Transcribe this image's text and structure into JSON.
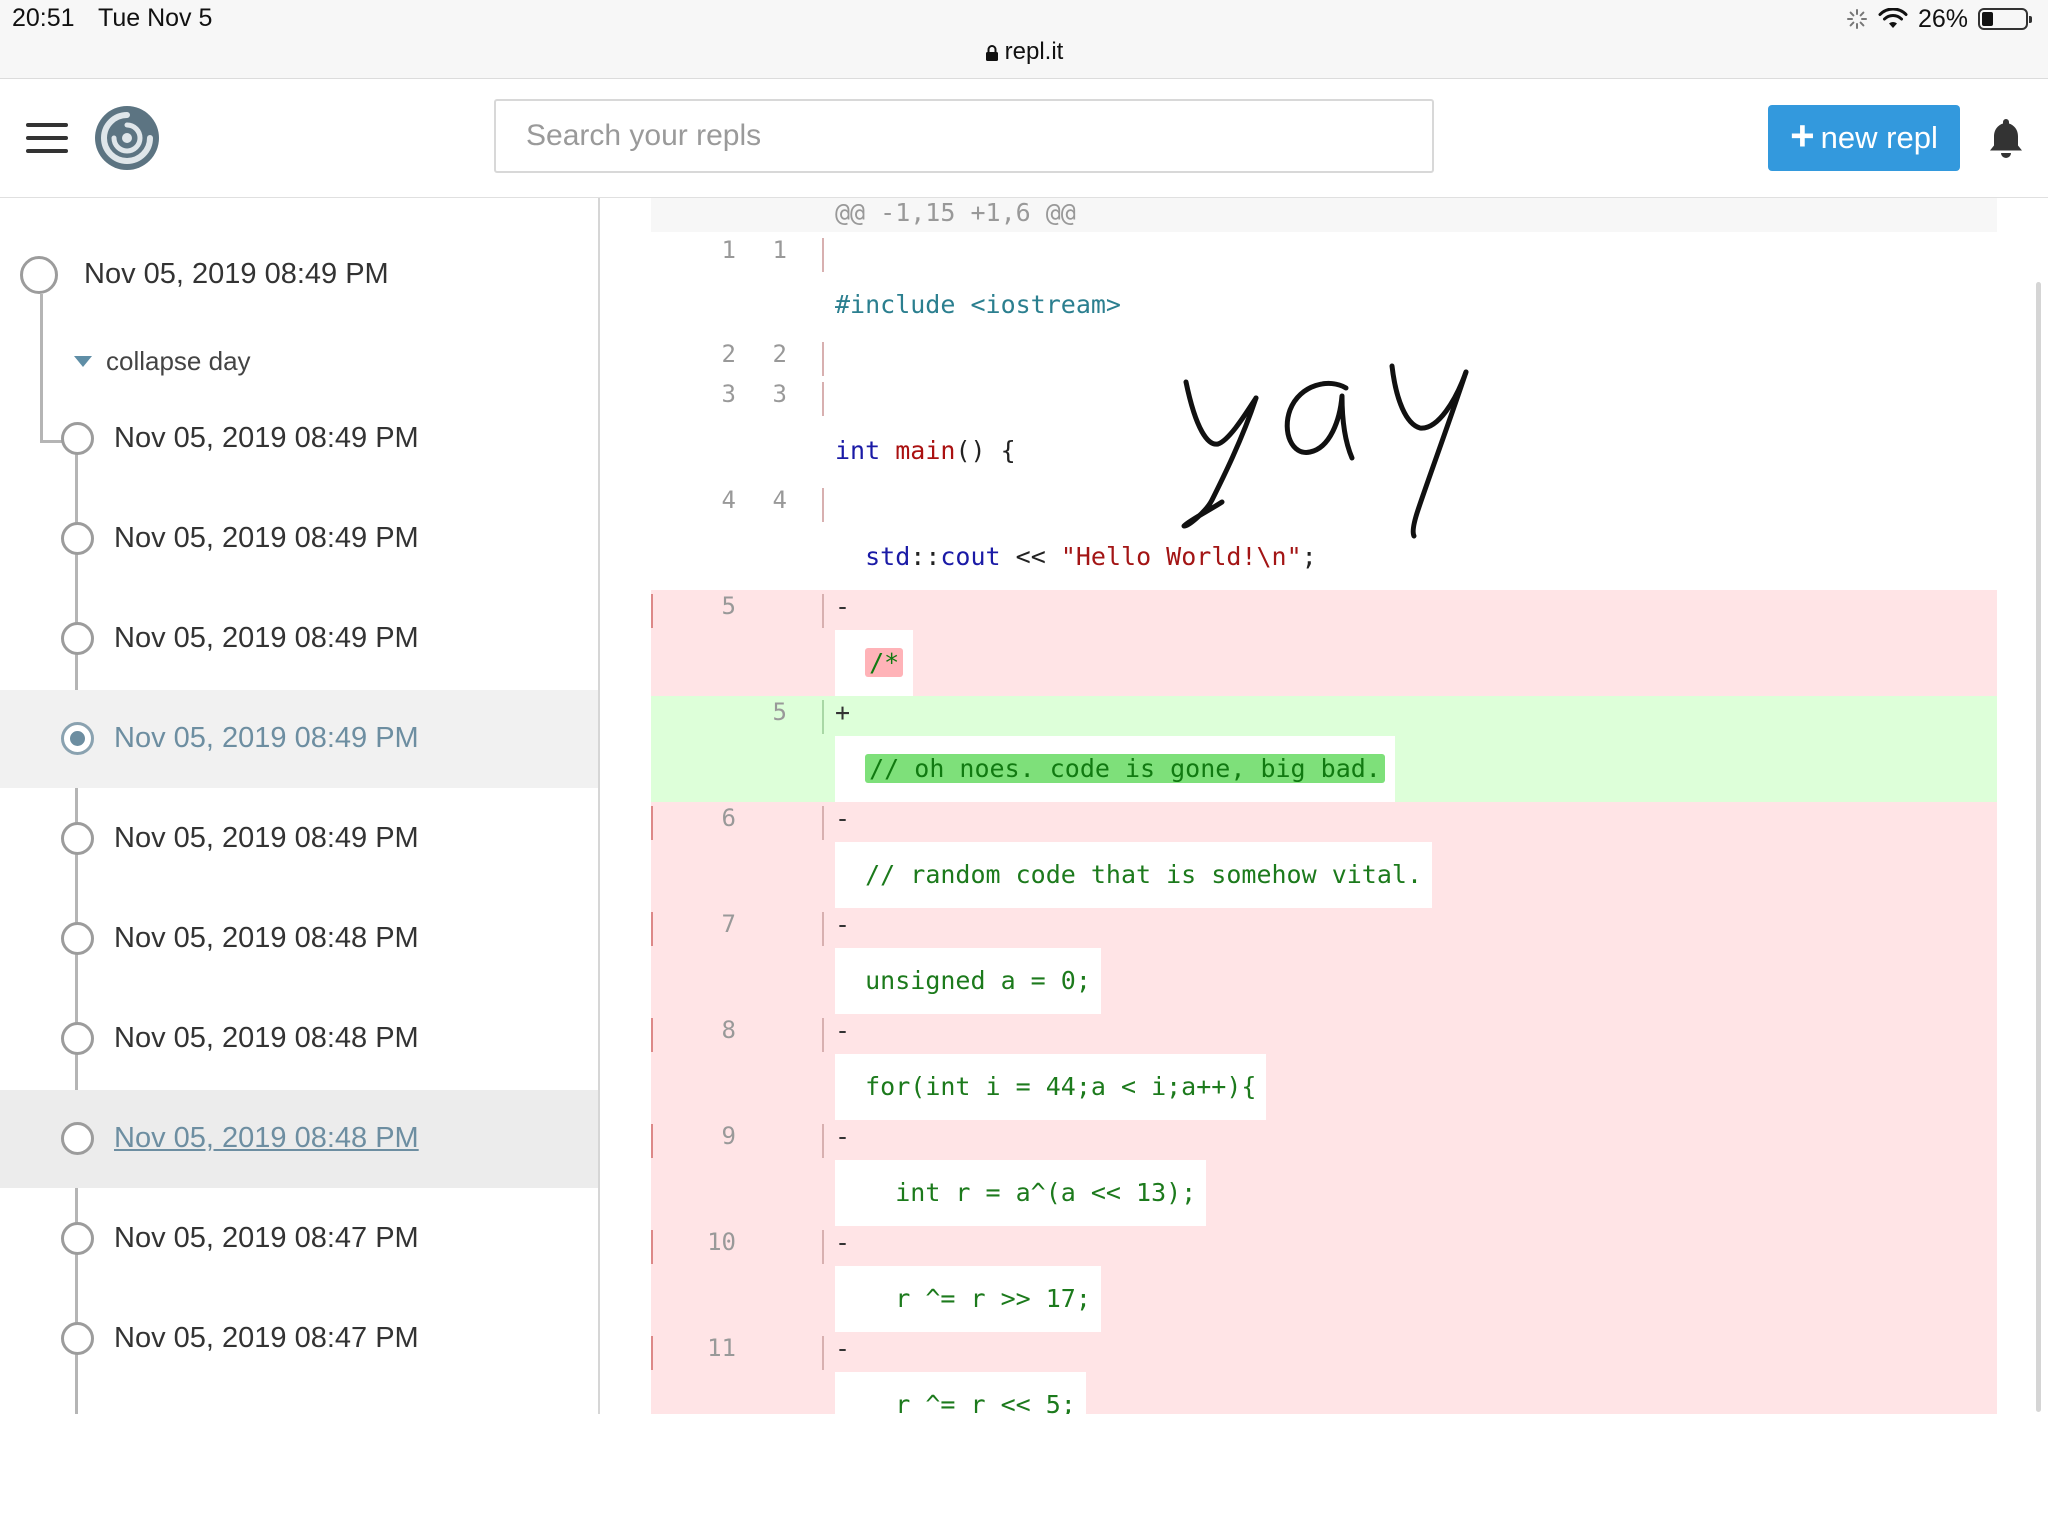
{
  "status_bar": {
    "time": "20:51",
    "day": "Tue Nov 5",
    "url": "repl.it",
    "battery": "26%",
    "battery_level": 0.26
  },
  "header": {
    "search_placeholder": "Search your repls",
    "new_repl_label": "new repl",
    "plus_symbol": "+"
  },
  "sidebar": {
    "root_timestamp": "Nov 05, 2019 08:49 PM",
    "collapse_label": "collapse day",
    "items": [
      {
        "label": "Nov 05, 2019 08:49 PM"
      },
      {
        "label": "Nov 05, 2019 08:49 PM"
      },
      {
        "label": "Nov 05, 2019 08:49 PM"
      },
      {
        "label": "Nov 05, 2019 08:49 PM",
        "state": "selected"
      },
      {
        "label": "Nov 05, 2019 08:49 PM"
      },
      {
        "label": "Nov 05, 2019 08:48 PM"
      },
      {
        "label": "Nov 05, 2019 08:48 PM"
      },
      {
        "label": "Nov 05, 2019 08:48 PM",
        "state": "hover"
      },
      {
        "label": "Nov 05, 2019 08:47 PM"
      },
      {
        "label": "Nov 05, 2019 08:47 PM"
      }
    ]
  },
  "diff": {
    "hunk_header": "@@ -1,15 +1,6 @@",
    "lines": [
      {
        "old": "1",
        "new": "1",
        "sign": "",
        "type": "ctx"
      },
      {
        "old": "2",
        "new": "2",
        "sign": "",
        "type": "ctx"
      },
      {
        "old": "3",
        "new": "3",
        "sign": "",
        "type": "ctx"
      },
      {
        "old": "4",
        "new": "4",
        "sign": "",
        "type": "ctx"
      },
      {
        "old": "5",
        "new": "",
        "sign": "-",
        "type": "del"
      },
      {
        "old": "",
        "new": "5",
        "sign": "+",
        "type": "add"
      },
      {
        "old": "6",
        "new": "",
        "sign": "-",
        "type": "del"
      },
      {
        "old": "7",
        "new": "",
        "sign": "-",
        "type": "del"
      },
      {
        "old": "8",
        "new": "",
        "sign": "-",
        "type": "del"
      },
      {
        "old": "9",
        "new": "",
        "sign": "-",
        "type": "del"
      },
      {
        "old": "10",
        "new": "",
        "sign": "-",
        "type": "del"
      },
      {
        "old": "11",
        "new": "",
        "sign": "-",
        "type": "del"
      }
    ],
    "code": {
      "include": "#include <iostream>",
      "int_kw": "int",
      "main_fn": "main",
      "main_rest": "() {",
      "std": "std",
      "scope": "::",
      "cout": "cout",
      "shift": " << ",
      "hello": "\"Hello World!\\n\"",
      "semicolon": ";",
      "comment_open": "/*",
      "added_comment": "// oh noes. code is gone, big bad.",
      "random_comment": "// random code that is somehow vital.",
      "unsigned_line": "unsigned a = 0;",
      "for_line": "for(int i = 44;a < i;a++){",
      "int_r_line": "  int r = a^(a << 13);",
      "r17_line": "  r ^= r >> 17;",
      "r5_line": "  r ^= r << 5;"
    }
  },
  "handwriting": "YaY",
  "colors": {
    "accent": "#3399dd",
    "deleted_bg": "#ffe4e6",
    "added_bg": "#ddffd9",
    "timeline_active": "#6d8ea1"
  }
}
